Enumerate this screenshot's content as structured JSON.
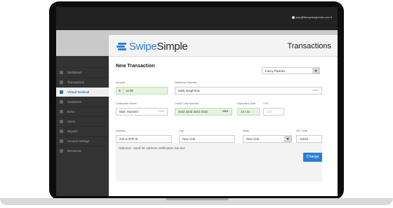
{
  "topbar": {
    "user": "joey@fancydoughnuts.com ▾"
  },
  "sidebar": {
    "items": [
      {
        "label": "Dashboard"
      },
      {
        "label": "Transactions"
      },
      {
        "label": "Virtual Terminal",
        "active": true
      },
      {
        "label": "Customers"
      },
      {
        "label": "Items"
      },
      {
        "label": "Users"
      },
      {
        "label": "Reports"
      },
      {
        "label": "Account Settings"
      },
      {
        "label": "Resources"
      }
    ]
  },
  "header": {
    "brand_prefix": "Swipe",
    "brand_suffix": "Simple",
    "page_title": "Transactions"
  },
  "form": {
    "title": "New Transaction",
    "merchant_select": "Fancy Pastries",
    "amount": {
      "label": "Amount",
      "prefix": "$",
      "value": "12.99"
    },
    "reference": {
      "label": "Reference Number",
      "value": "Daily doughnuts",
      "counter": "15/64"
    },
    "cardholder": {
      "label": "Cardholder Name",
      "value": "Marc Hummel",
      "counter": "11/26"
    },
    "card_number": {
      "label": "Credit Card Number",
      "value": "4242 4242 4242 4242",
      "brand": "VISA"
    },
    "expiration": {
      "label": "Expiration Date",
      "value": "12 / 21"
    },
    "cvv": {
      "label": "CVV",
      "placeholder": "123"
    },
    "avs_title": "Optional - Used for Address Verification Service",
    "address": {
      "label": "Address",
      "value": "240 w 37th St"
    },
    "city": {
      "label": "City",
      "value": "New York"
    },
    "state": {
      "label": "State",
      "value": "New York"
    },
    "zip": {
      "label": "ZIP Code",
      "value": "10018"
    },
    "charge_label": "Charge"
  }
}
